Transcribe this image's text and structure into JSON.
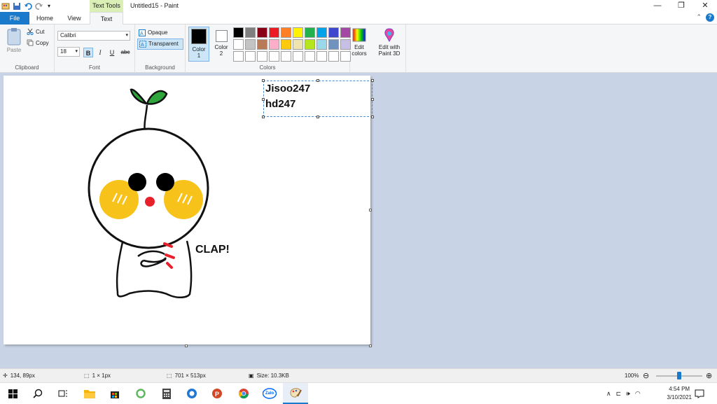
{
  "window": {
    "title": "Untitled15 - Paint",
    "context_tab": "Text Tools",
    "controls": {
      "minimize": "—",
      "restore": "❐",
      "close": "✕"
    }
  },
  "tabs": {
    "file": "File",
    "home": "Home",
    "view": "View",
    "text": "Text"
  },
  "ribbon": {
    "clipboard": {
      "label": "Clipboard",
      "paste": "Paste",
      "cut": "Cut",
      "copy": "Copy"
    },
    "font": {
      "label": "Font",
      "family": "Calibri",
      "size": "18",
      "bold": "B",
      "italic": "I",
      "underline": "U",
      "strike": "abc"
    },
    "background": {
      "label": "Background",
      "opaque": "Opaque",
      "transparent": "Transparent"
    },
    "colors": {
      "label": "Colors",
      "color1": "Color\n1",
      "color1_label": "Color",
      "color1_num": "1",
      "color2_label": "Color",
      "color2_num": "2",
      "color1_value": "#000000",
      "color2_value": "#ffffff",
      "edit_colors": "Edit colors",
      "edit_colors_l1": "Edit",
      "edit_colors_l2": "colors",
      "paint3d_l1": "Edit with",
      "paint3d_l2": "Paint 3D",
      "palette": [
        "#000000",
        "#7f7f7f",
        "#880015",
        "#ed1c24",
        "#ff7f27",
        "#fff200",
        "#22b14c",
        "#00a2e8",
        "#3f48cc",
        "#a349a4",
        "#ffffff",
        "#c3c3c3",
        "#b97a57",
        "#ffaec9",
        "#ffc90e",
        "#efe4b0",
        "#b5e61d",
        "#99d9ea",
        "#7092be",
        "#c8bfe7",
        "#ffffff",
        "#ffffff",
        "#ffffff",
        "#ffffff",
        "#ffffff",
        "#ffffff",
        "#ffffff",
        "#ffffff",
        "#ffffff",
        "#ffffff"
      ]
    }
  },
  "canvas": {
    "text_lines": [
      "Jisoo247",
      "hd247"
    ],
    "clap_text": "CLAP!"
  },
  "status": {
    "cursor": "134, 89px",
    "selection": "1 × 1px",
    "canvas_size": "701 × 513px",
    "file_size": "Size: 10.3KB",
    "zoom": "100%",
    "zoom_level": 0.5
  },
  "taskbar": {
    "time": "4:54 PM",
    "date": "3/10/2021",
    "zalo": "Zalo"
  }
}
